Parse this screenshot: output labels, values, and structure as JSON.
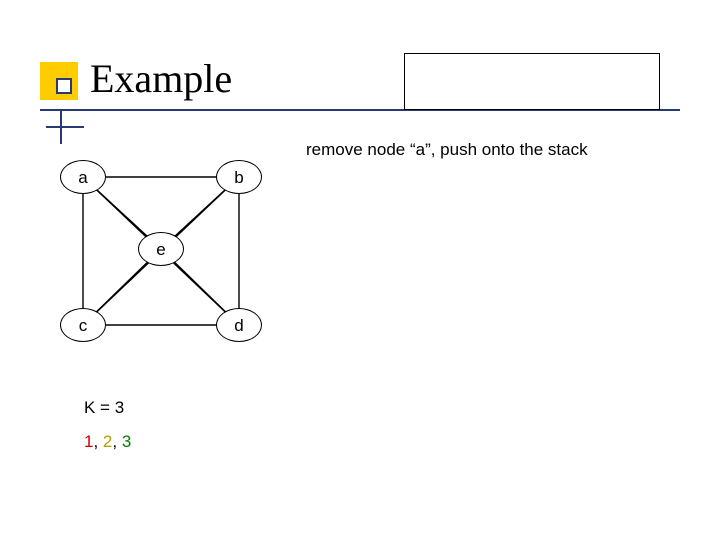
{
  "slide": {
    "title": "Example",
    "caption": "remove node “a”, push onto the stack",
    "k_label": "K = 3",
    "colors": {
      "c1": "1",
      "sep1": ", ",
      "c2": "2",
      "sep2": ", ",
      "c3": "3"
    }
  },
  "graph": {
    "nodes": {
      "a": "a",
      "b": "b",
      "c": "c",
      "d": "d",
      "e": "e"
    }
  },
  "chart_data": {
    "type": "diagram",
    "description": "Undirected interference graph with five nodes and a stack operation step in graph-coloring register allocation.",
    "nodes": [
      "a",
      "b",
      "c",
      "d",
      "e"
    ],
    "edges": [
      [
        "a",
        "b"
      ],
      [
        "a",
        "c"
      ],
      [
        "a",
        "e"
      ],
      [
        "a",
        "d"
      ],
      [
        "b",
        "c"
      ],
      [
        "b",
        "e"
      ],
      [
        "b",
        "d"
      ],
      [
        "c",
        "e"
      ],
      [
        "c",
        "d"
      ],
      [
        "d",
        "e"
      ]
    ],
    "K": 3,
    "color_labels": [
      {
        "label": "1",
        "color": "#cc0000"
      },
      {
        "label": "2",
        "color": "#b0a000"
      },
      {
        "label": "3",
        "color": "#008000"
      }
    ],
    "step_annotation": "remove node \"a\", push onto the stack"
  }
}
